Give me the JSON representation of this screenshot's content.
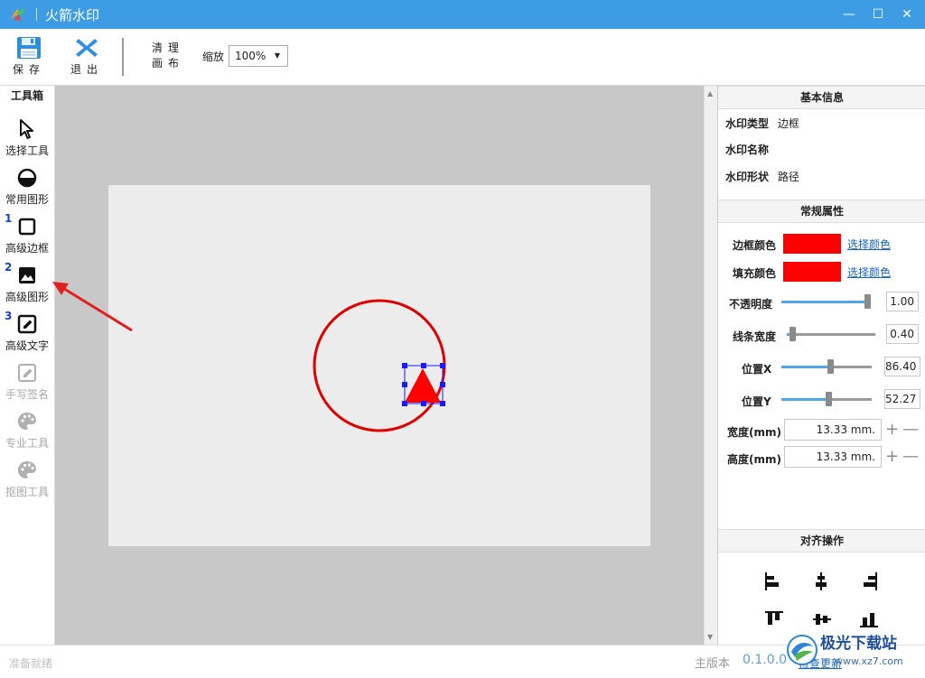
{
  "window": {
    "title": "火箭水印",
    "minimize": "—",
    "maximize": "☐",
    "close": "✕"
  },
  "toolbar": {
    "save": "保存",
    "exit": "退出",
    "clear_line1": "清理",
    "clear_line2": "画布",
    "zoom_label": "缩放",
    "zoom_value": "100%"
  },
  "toolbox": {
    "title": "工具箱",
    "items": [
      {
        "label": "选择工具",
        "num": ""
      },
      {
        "label": "常用图形",
        "num": ""
      },
      {
        "label": "高级边框",
        "num": "1"
      },
      {
        "label": "高级图形",
        "num": "2"
      },
      {
        "label": "高级文字",
        "num": "3"
      },
      {
        "label": "手写签名",
        "num": ""
      },
      {
        "label": "专业工具",
        "num": ""
      },
      {
        "label": "抠图工具",
        "num": ""
      }
    ]
  },
  "props": {
    "basic_title": "基本信息",
    "type_label": "水印类型",
    "type_value": "边框",
    "name_label": "水印名称",
    "name_value": "",
    "shape_label": "水印形状",
    "shape_value": "路径",
    "general_title": "常规属性",
    "border_color_label": "边框颜色",
    "fill_color_label": "填充颜色",
    "pick_color": "选择颜色",
    "border_color": "#ff0000",
    "fill_color": "#ff0000",
    "opacity_label": "不透明度",
    "opacity_value": "1.00",
    "line_width_label": "线条宽度",
    "line_width_value": "0.40",
    "pos_x_label": "位置X",
    "pos_x_value": "86.40",
    "pos_y_label": "位置Y",
    "pos_y_value": "52.27",
    "width_label": "宽度(mm)",
    "width_value": "13.33 mm.",
    "height_label": "高度(mm)",
    "height_value": "13.33 mm.",
    "plus": "+",
    "minus": "—",
    "align_title": "对齐操作"
  },
  "status": {
    "left": "准备就绪",
    "version_label": "主版本",
    "version_value": "0.1.0.0",
    "check_update": "检查更新"
  },
  "watermark": {
    "name": "极光下载站",
    "url": "www.xz7.com"
  }
}
